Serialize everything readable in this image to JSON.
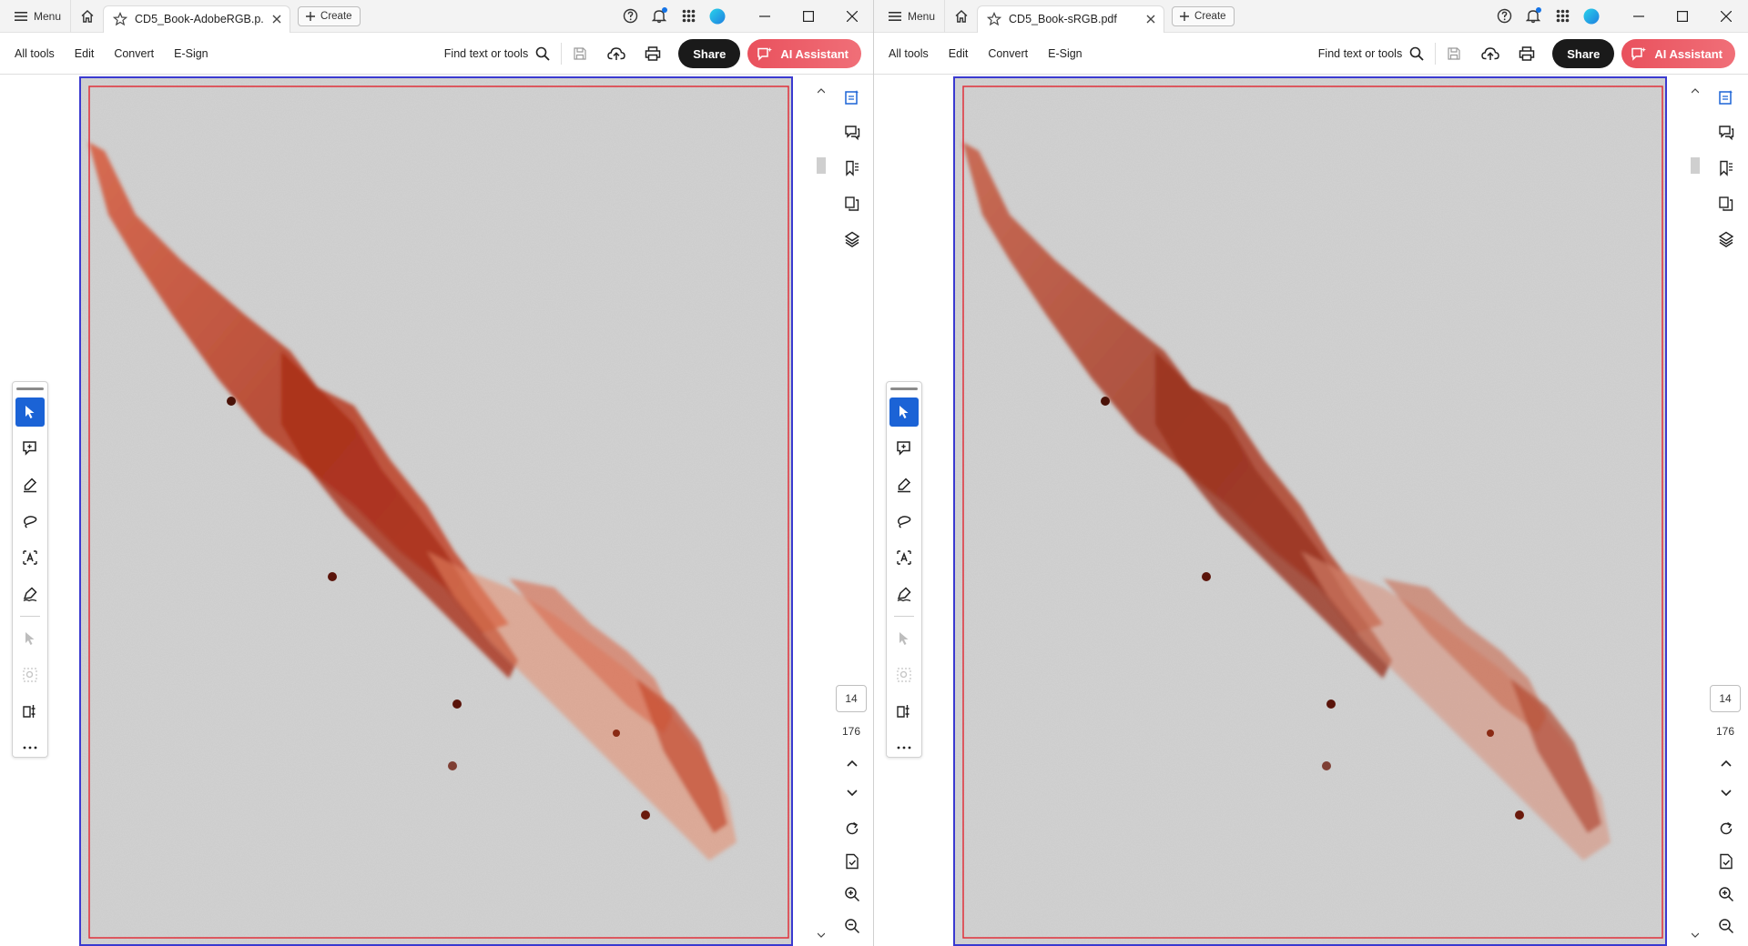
{
  "windows": [
    {
      "menu_label": "Menu",
      "tab_title": "CD5_Book-AdobeRGB.p...",
      "create_label": "Create",
      "toolbar": {
        "all_tools": "All tools",
        "edit": "Edit",
        "convert": "Convert",
        "esign": "E-Sign",
        "find_label": "Find text or tools",
        "share_label": "Share",
        "ai_label": "AI Assistant"
      },
      "page_number": "14",
      "page_total": "176"
    },
    {
      "menu_label": "Menu",
      "tab_title": "CD5_Book-sRGB.pdf",
      "create_label": "Create",
      "toolbar": {
        "all_tools": "All tools",
        "edit": "Edit",
        "convert": "Convert",
        "esign": "E-Sign",
        "find_label": "Find text or tools",
        "share_label": "Share",
        "ai_label": "AI Assistant"
      },
      "page_number": "14",
      "page_total": "176"
    }
  ],
  "colors": {
    "select_tool_active": "#1b63d6",
    "share_button": "#1a1a1a",
    "ai_button": "#ee5a65",
    "page_border": "#3a3ad0",
    "trim_box": "#e0303a",
    "paint_dark": "#a8321c",
    "paint_light": "#e58a6a"
  },
  "icons": {
    "titlebar": [
      "hamburger-icon",
      "home-icon",
      "star-icon",
      "close-tab-icon",
      "plus-icon",
      "help-icon",
      "bell-icon",
      "apps-grid-icon",
      "profile-icon",
      "minimize-icon",
      "maximize-icon",
      "close-window-icon"
    ],
    "toolbar": [
      "search-icon",
      "save-icon",
      "upload-cloud-icon",
      "print-icon",
      "ai-chat-icon"
    ],
    "left_tools": [
      "select-arrow-icon",
      "add-comment-icon",
      "highlight-pen-icon",
      "draw-lasso-icon",
      "text-select-icon",
      "fill-sign-icon",
      "pointer-disabled-icon",
      "zoom-marquee-icon",
      "edit-compare-icon",
      "more-icon"
    ],
    "right_rail": [
      "page-thumbnails-icon",
      "comments-icon",
      "bookmarks-icon",
      "pages-icon",
      "layers-icon",
      "chevron-up-icon",
      "chevron-down-icon",
      "rotate-icon",
      "save-doc-icon",
      "zoom-in-icon",
      "zoom-out-icon"
    ]
  }
}
